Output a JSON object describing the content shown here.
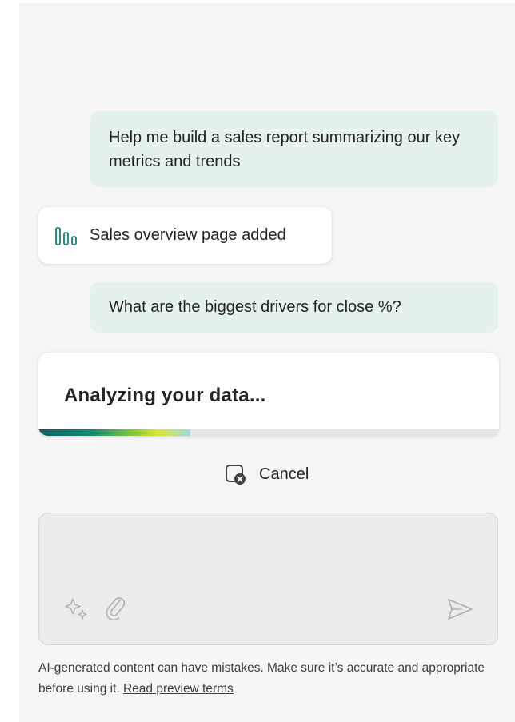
{
  "messages": [
    {
      "role": "user",
      "text": "Help me build a sales report summarizing our key metrics and trends"
    },
    {
      "role": "status",
      "icon": "bar-chart-icon",
      "text": "Sales overview page added"
    },
    {
      "role": "user",
      "text": "What are the biggest drivers for close %?"
    }
  ],
  "analysis": {
    "title": "Analyzing your data...",
    "progress": 0.33
  },
  "cancel": {
    "icon": "stop-icon",
    "label": "Cancel"
  },
  "composer": {
    "value": "",
    "tools": [
      "sparkle-icon",
      "attach-icon"
    ],
    "send_icon": "send-icon"
  },
  "disclaimer": {
    "text": "AI-generated content can have mistakes. Make sure it’s accurate and appropriate before using it. ",
    "link_text": "Read preview terms"
  },
  "colors": {
    "user_bubble": "#e4f1ed",
    "pane_background": "#f6f6f6",
    "progress_start": "#0e5f63",
    "progress_mid": "#8fcf3a",
    "progress_end": "#d9ea2a",
    "icon_teal": "#1a7d7a"
  }
}
